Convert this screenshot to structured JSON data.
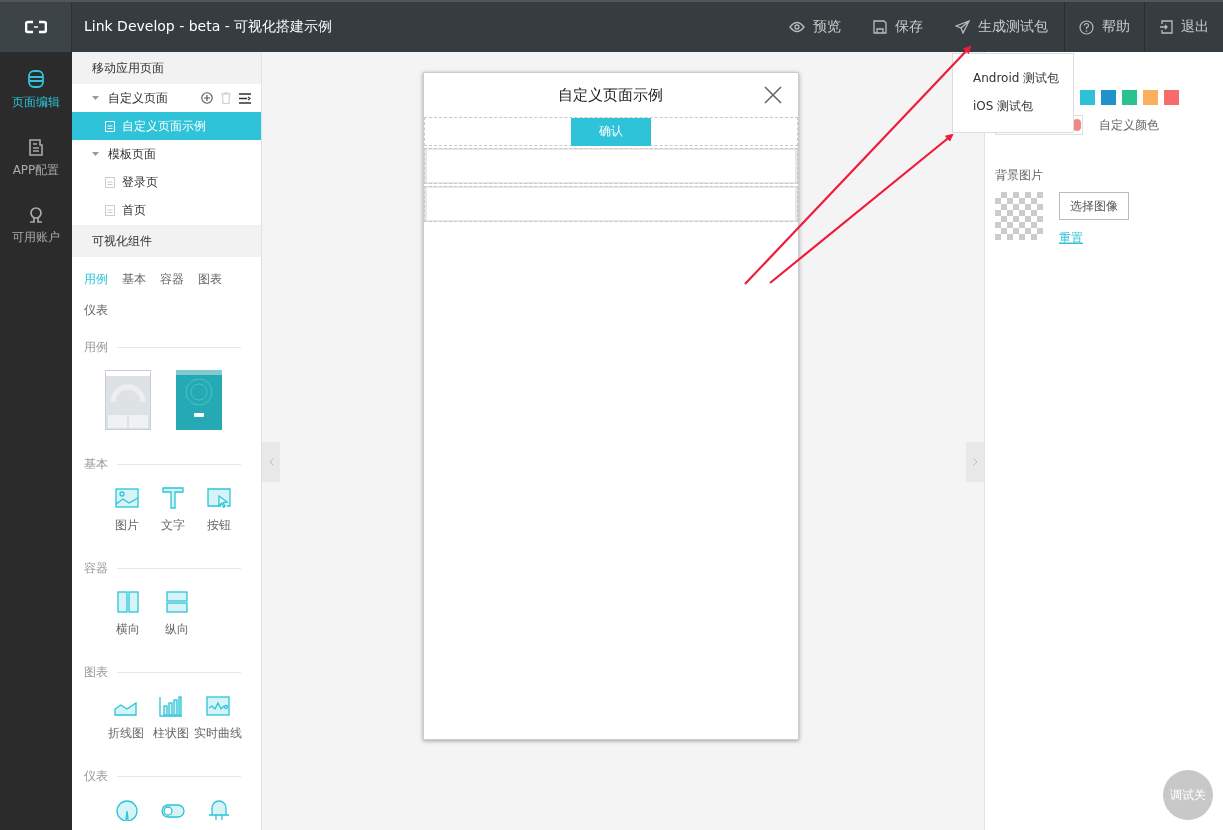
{
  "app": {
    "title": "Link Develop - beta - 可视化搭建示例"
  },
  "toolbar": [
    {
      "label": "预览",
      "kind": "eye",
      "divided": false
    },
    {
      "label": "保存",
      "kind": "save",
      "divided": false
    },
    {
      "label": "生成测试包",
      "kind": "send",
      "divided": false
    },
    {
      "label": "帮助",
      "kind": "help",
      "divided": true
    },
    {
      "label": "退出",
      "kind": "exit",
      "divided": true
    }
  ],
  "build_menu": [
    {
      "label": "Android 测试包"
    },
    {
      "label": "iOS 测试包"
    }
  ],
  "nav": [
    {
      "label": "页面编辑",
      "kind": "pages",
      "selected": true
    },
    {
      "label": "APP配置",
      "kind": "config",
      "selected": false
    },
    {
      "label": "可用账户",
      "kind": "account",
      "selected": false
    }
  ],
  "pages_panel": {
    "title": "移动应用页面",
    "tree": [
      {
        "label": "自定义页面",
        "expanded": true,
        "actions": true,
        "selected": false,
        "children": [
          {
            "label": "自定义页面示例",
            "selected": true
          }
        ]
      },
      {
        "label": "模板页面",
        "expanded": true,
        "actions": false,
        "selected": false,
        "children": [
          {
            "label": "登录页",
            "selected": false
          },
          {
            "label": "首页",
            "selected": false
          }
        ]
      }
    ]
  },
  "components_panel": {
    "title": "可视化组件",
    "tabs": [
      {
        "label": "用例",
        "selected": true
      },
      {
        "label": "基本",
        "selected": false
      },
      {
        "label": "容器",
        "selected": false
      },
      {
        "label": "图表",
        "selected": false
      },
      {
        "label": "仪表",
        "selected": false
      }
    ],
    "groups": [
      {
        "title": "用例",
        "items": [
          {
            "kind": "gauge-example"
          },
          {
            "kind": "teal-example"
          }
        ]
      },
      {
        "title": "基本",
        "items": [
          {
            "kind": "image",
            "label": "图片"
          },
          {
            "kind": "text",
            "label": "文字"
          },
          {
            "kind": "button",
            "label": "按钮"
          }
        ]
      },
      {
        "title": "容器",
        "items": [
          {
            "kind": "horizontal",
            "label": "横向"
          },
          {
            "kind": "vertical",
            "label": "纵向"
          }
        ]
      },
      {
        "title": "图表",
        "items": [
          {
            "kind": "line-chart",
            "label": "折线图"
          },
          {
            "kind": "bar-chart",
            "label": "柱状图"
          },
          {
            "kind": "realtime",
            "label": "实时曲线"
          }
        ]
      },
      {
        "title": "仪表",
        "items": [
          {
            "kind": "dial"
          },
          {
            "kind": "switch"
          },
          {
            "kind": "bulb"
          }
        ]
      }
    ]
  },
  "phone": {
    "title": "自定义页面示例",
    "button": "确认"
  },
  "properties": {
    "swatches": [
      {
        "color": "#2fc1d6"
      },
      {
        "color": "#2193cc"
      },
      {
        "color": "#2cc28e"
      },
      {
        "color": "#f9b15e"
      },
      {
        "color": "#f86b6b"
      }
    ],
    "custom_color_label": "自定义颜色",
    "background_label": "背景图片",
    "choose_button": "选择图像",
    "reset_link": "重置"
  },
  "debug_button": "调试关"
}
